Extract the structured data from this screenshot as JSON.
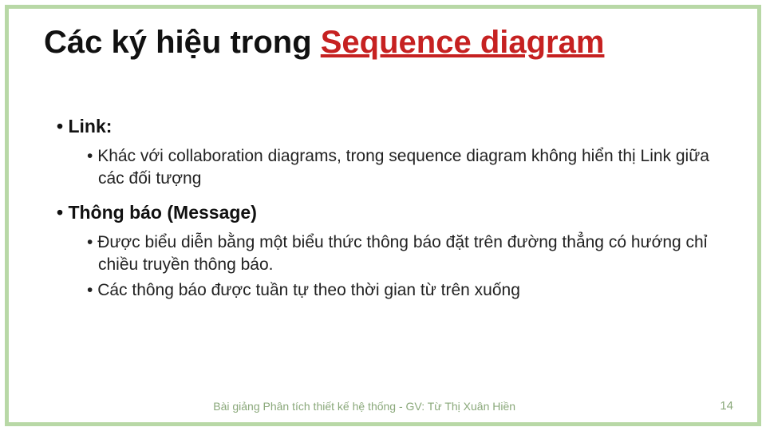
{
  "title": {
    "pre": "Các ký hiệu trong ",
    "highlight": "Sequence diagram"
  },
  "sections": {
    "s1": {
      "heading": "Link",
      "colon": ":",
      "bullet1": "Khác với  collaboration diagrams, trong sequence diagram không hiển thị Link giữa các đối tượng"
    },
    "s2": {
      "heading": "Thông báo (Message)",
      "bullet1": "Được biểu diễn bằng một biểu thức thông báo đặt trên đường thẳng có hướng chỉ chiều truyền thông báo.",
      "bullet2": "Các thông báo được tuần tự theo thời gian từ trên xuống"
    }
  },
  "footer": {
    "text": "Bài giảng Phân tích thiết kế hệ thống - GV: Từ Thị Xuân Hiền",
    "page": "14"
  }
}
